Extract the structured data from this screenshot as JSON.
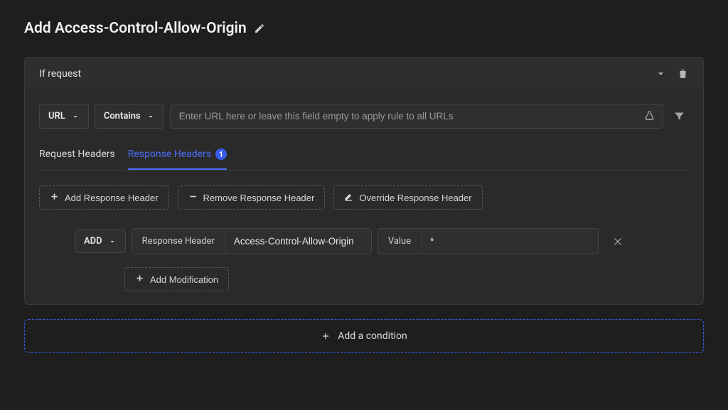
{
  "page_title": "Add Access-Control-Allow-Origin",
  "card": {
    "heading": "If request",
    "source_dropdown": "URL",
    "operator_dropdown": "Contains",
    "url_placeholder": "Enter URL here or leave this field empty to apply rule to all URLs",
    "url_value": ""
  },
  "tabs": {
    "request": "Request Headers",
    "response": "Response Headers",
    "response_badge": "1"
  },
  "action_buttons": {
    "add": "Add Response Header",
    "remove": "Remove Response Header",
    "override": "Override Response Header"
  },
  "modification": {
    "type_label": "ADD",
    "header_label": "Response Header",
    "header_value": "Access-Control-Allow-Origin",
    "value_label": "Value",
    "value_value": "*",
    "add_mod_label": "Add Modification"
  },
  "add_condition_label": "Add a condition"
}
